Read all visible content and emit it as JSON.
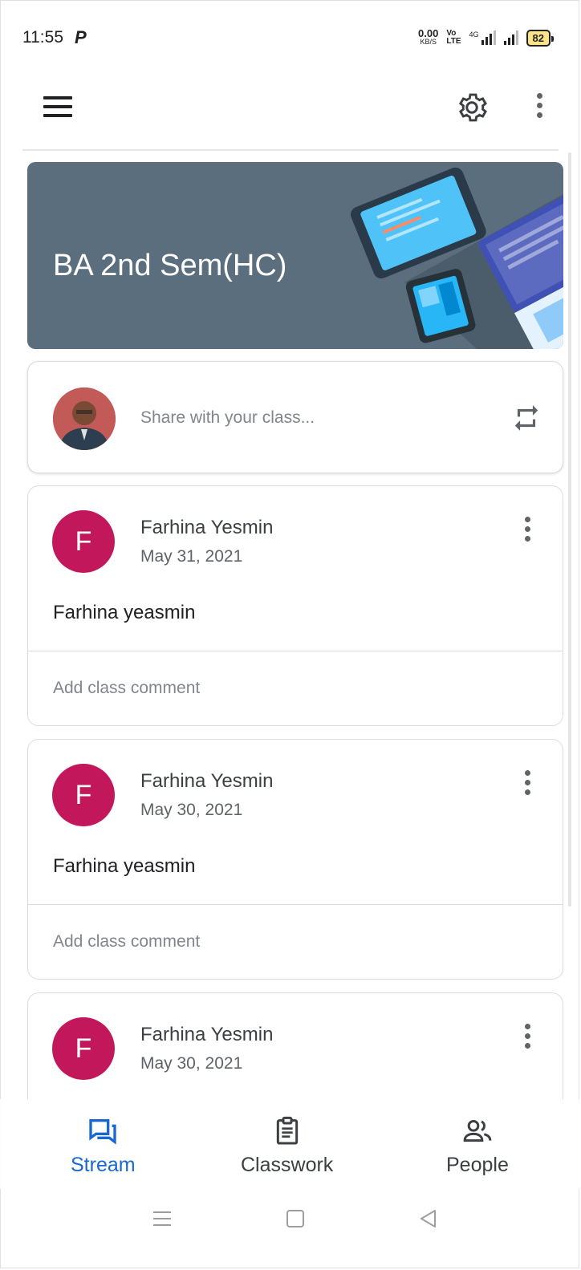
{
  "status_bar": {
    "time": "11:55",
    "data_rate_value": "0.00",
    "data_rate_unit": "KB/S",
    "volte_top": "Vo",
    "volte_bottom": "LTE",
    "network": "4G",
    "battery": "82"
  },
  "class": {
    "title": "BA 2nd Sem(HC)"
  },
  "share": {
    "placeholder": "Share with your class..."
  },
  "posts": [
    {
      "author": "Farhina Yesmin",
      "date": "May 31, 2021",
      "body": "Farhina yeasmin",
      "comment_placeholder": "Add class comment",
      "initial": "F"
    },
    {
      "author": "Farhina Yesmin",
      "date": "May 30, 2021",
      "body": "Farhina yeasmin",
      "comment_placeholder": "Add class comment",
      "initial": "F"
    },
    {
      "author": "Farhina Yesmin",
      "date": "May 30, 2021",
      "initial": "F"
    }
  ],
  "bottom_nav": {
    "tabs": [
      {
        "label": "Stream",
        "icon": "stream-icon",
        "active": true
      },
      {
        "label": "Classwork",
        "icon": "clipboard-icon",
        "active": false
      },
      {
        "label": "People",
        "icon": "people-icon",
        "active": false
      }
    ]
  },
  "colors": {
    "accent": "#1967d2",
    "avatar": "#c2185b",
    "banner": "#5b6e7d"
  }
}
